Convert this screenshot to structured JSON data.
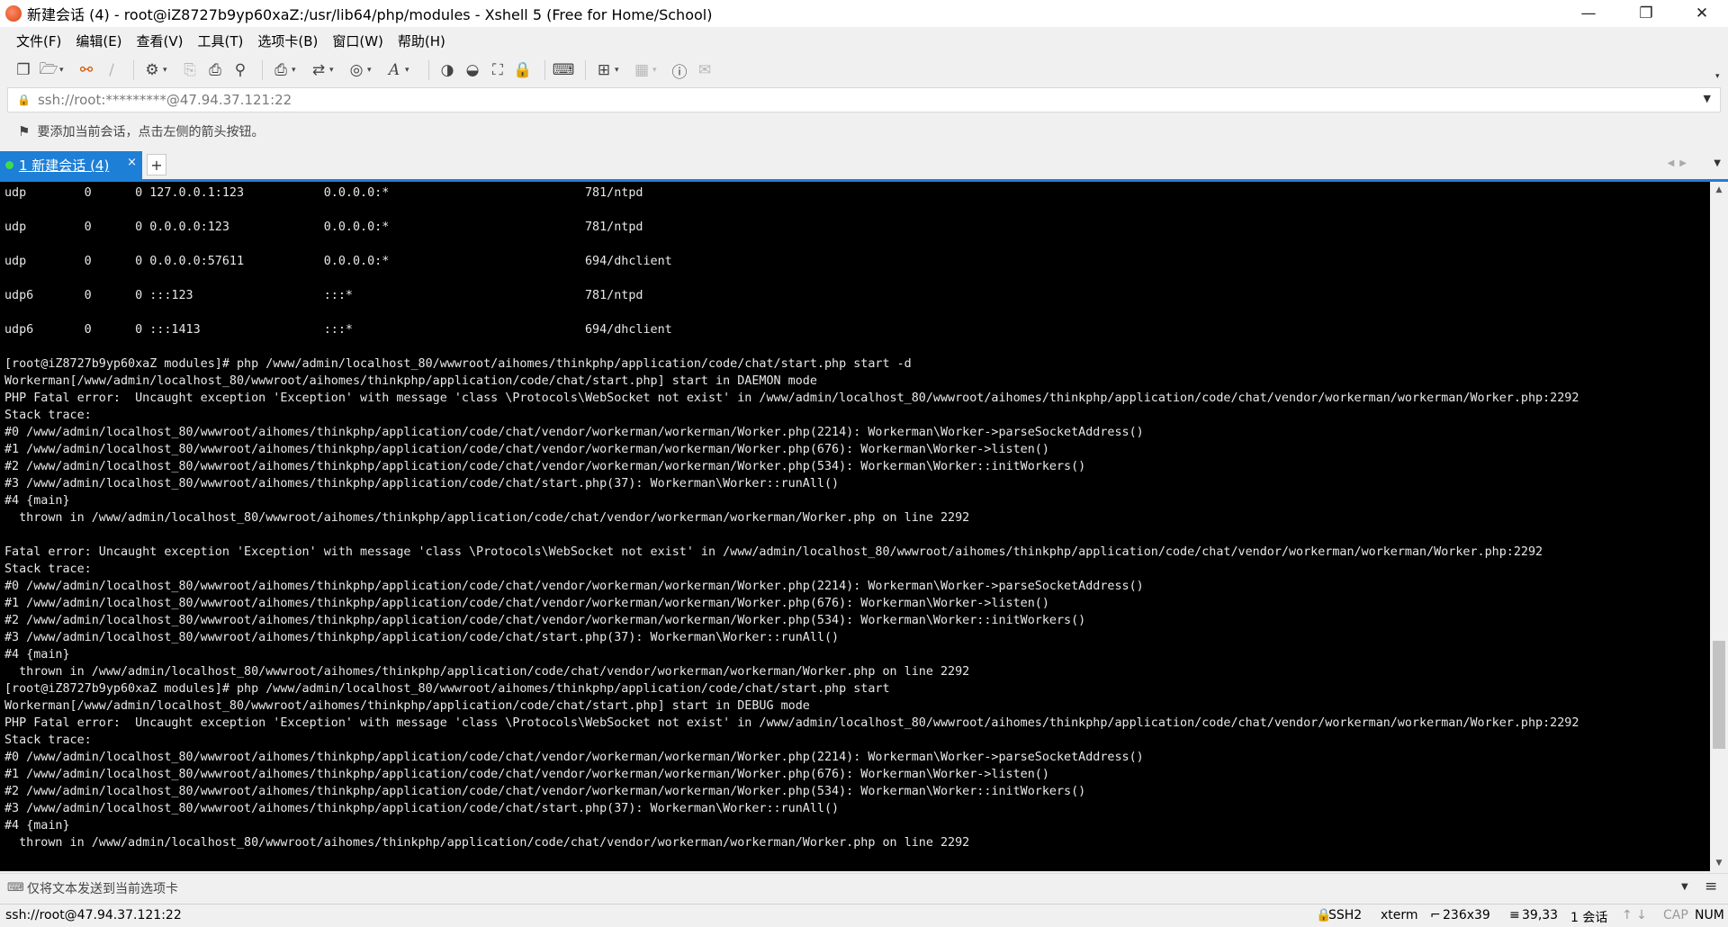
{
  "window": {
    "title": "新建会话 (4) - root@iZ8727b9yp60xaZ:/usr/lib64/php/modules - Xshell 5 (Free for Home/School)",
    "controls": {
      "minimize": "—",
      "restore": "❐",
      "close": "✕"
    }
  },
  "menu": [
    "文件(F)",
    "编辑(E)",
    "查看(V)",
    "工具(T)",
    "选项卡(B)",
    "窗口(W)",
    "帮助(H)"
  ],
  "toolbar": {
    "icons": [
      "new-session-icon",
      "open-folder-icon",
      "connect-icon",
      "disconnect-icon",
      "properties-icon",
      "copy-icon",
      "paste-icon",
      "find-icon",
      "print-icon",
      "transfer-icon",
      "globe-icon",
      "font-icon",
      "xftp-icon",
      "xmanager-icon",
      "fullscreen-icon",
      "lock-icon",
      "keyboard-icon",
      "new-tab-icon",
      "layout-icon",
      "help-icon",
      "comment-icon"
    ]
  },
  "address": {
    "value": "ssh://root:*********@47.94.37.121:22"
  },
  "hint": {
    "text": "要添加当前会话，点击左侧的箭头按钮。"
  },
  "tabs": [
    {
      "label": "1 新建会话 (4)",
      "active": true
    }
  ],
  "terminal": {
    "lines": [
      "udp        0      0 127.0.0.1:123           0.0.0.0:*                           781/ntpd",
      "",
      "udp        0      0 0.0.0.0:123             0.0.0.0:*                           781/ntpd",
      "",
      "udp        0      0 0.0.0.0:57611           0.0.0.0:*                           694/dhclient",
      "",
      "udp6       0      0 :::123                  :::*                                781/ntpd",
      "",
      "udp6       0      0 :::1413                 :::*                                694/dhclient",
      "",
      "[root@iZ8727b9yp60xaZ modules]# php /www/admin/localhost_80/wwwroot/aihomes/thinkphp/application/code/chat/start.php start -d",
      "Workerman[/www/admin/localhost_80/wwwroot/aihomes/thinkphp/application/code/chat/start.php] start in DAEMON mode",
      "PHP Fatal error:  Uncaught exception 'Exception' with message 'class \\Protocols\\WebSocket not exist' in /www/admin/localhost_80/wwwroot/aihomes/thinkphp/application/code/chat/vendor/workerman/workerman/Worker.php:2292",
      "Stack trace:",
      "#0 /www/admin/localhost_80/wwwroot/aihomes/thinkphp/application/code/chat/vendor/workerman/workerman/Worker.php(2214): Workerman\\Worker->parseSocketAddress()",
      "#1 /www/admin/localhost_80/wwwroot/aihomes/thinkphp/application/code/chat/vendor/workerman/workerman/Worker.php(676): Workerman\\Worker->listen()",
      "#2 /www/admin/localhost_80/wwwroot/aihomes/thinkphp/application/code/chat/vendor/workerman/workerman/Worker.php(534): Workerman\\Worker::initWorkers()",
      "#3 /www/admin/localhost_80/wwwroot/aihomes/thinkphp/application/code/chat/start.php(37): Workerman\\Worker::runAll()",
      "#4 {main}",
      "  thrown in /www/admin/localhost_80/wwwroot/aihomes/thinkphp/application/code/chat/vendor/workerman/workerman/Worker.php on line 2292",
      "",
      "Fatal error: Uncaught exception 'Exception' with message 'class \\Protocols\\WebSocket not exist' in /www/admin/localhost_80/wwwroot/aihomes/thinkphp/application/code/chat/vendor/workerman/workerman/Worker.php:2292",
      "Stack trace:",
      "#0 /www/admin/localhost_80/wwwroot/aihomes/thinkphp/application/code/chat/vendor/workerman/workerman/Worker.php(2214): Workerman\\Worker->parseSocketAddress()",
      "#1 /www/admin/localhost_80/wwwroot/aihomes/thinkphp/application/code/chat/vendor/workerman/workerman/Worker.php(676): Workerman\\Worker->listen()",
      "#2 /www/admin/localhost_80/wwwroot/aihomes/thinkphp/application/code/chat/vendor/workerman/workerman/Worker.php(534): Workerman\\Worker::initWorkers()",
      "#3 /www/admin/localhost_80/wwwroot/aihomes/thinkphp/application/code/chat/start.php(37): Workerman\\Worker::runAll()",
      "#4 {main}",
      "  thrown in /www/admin/localhost_80/wwwroot/aihomes/thinkphp/application/code/chat/vendor/workerman/workerman/Worker.php on line 2292",
      "[root@iZ8727b9yp60xaZ modules]# php /www/admin/localhost_80/wwwroot/aihomes/thinkphp/application/code/chat/start.php start",
      "Workerman[/www/admin/localhost_80/wwwroot/aihomes/thinkphp/application/code/chat/start.php] start in DEBUG mode",
      "PHP Fatal error:  Uncaught exception 'Exception' with message 'class \\Protocols\\WebSocket not exist' in /www/admin/localhost_80/wwwroot/aihomes/thinkphp/application/code/chat/vendor/workerman/workerman/Worker.php:2292",
      "Stack trace:",
      "#0 /www/admin/localhost_80/wwwroot/aihomes/thinkphp/application/code/chat/vendor/workerman/workerman/Worker.php(2214): Workerman\\Worker->parseSocketAddress()",
      "#1 /www/admin/localhost_80/wwwroot/aihomes/thinkphp/application/code/chat/vendor/workerman/workerman/Worker.php(676): Workerman\\Worker->listen()",
      "#2 /www/admin/localhost_80/wwwroot/aihomes/thinkphp/application/code/chat/vendor/workerman/workerman/Worker.php(534): Workerman\\Worker::initWorkers()",
      "#3 /www/admin/localhost_80/wwwroot/aihomes/thinkphp/application/code/chat/start.php(37): Workerman\\Worker::runAll()",
      "#4 {main}",
      "  thrown in /www/admin/localhost_80/wwwroot/aihomes/thinkphp/application/code/chat/vendor/workerman/workerman/Worker.php on line 2292"
    ]
  },
  "sendbar": {
    "placeholder": "仅将文本发送到当前选项卡"
  },
  "status": {
    "connection": "ssh://root@47.94.37.121:22",
    "protocol": "SSH2",
    "terminal_type": "xterm",
    "size": "236x39",
    "cursor": "39,33",
    "sessions": "1 会话",
    "caps": "CAP",
    "num": "NUM"
  },
  "colors": {
    "accent": "#1e7fd6",
    "terminal_bg": "#000000",
    "terminal_fg": "#e8e8e8",
    "connected": "#3ddc4d"
  }
}
